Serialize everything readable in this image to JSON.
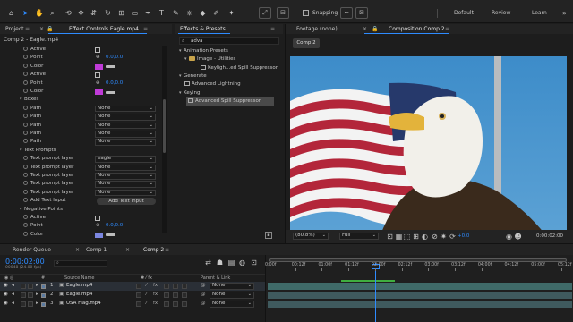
{
  "workspace": {
    "snapping_label": "Snapping",
    "workspaces": [
      "Default",
      "Review",
      "Learn"
    ]
  },
  "left_panel": {
    "tabs": [
      "Project",
      "Effect Controls Eagle.mp4"
    ],
    "header": "Comp 2 - Eagle.mp4",
    "rows": [
      {
        "label": "Active",
        "type": "checkbox"
      },
      {
        "label": "Point",
        "type": "point",
        "value": "0.0,0.0"
      },
      {
        "label": "Color",
        "type": "color",
        "color": "#c03bd8"
      },
      {
        "label": "Active",
        "type": "checkbox"
      },
      {
        "label": "Point",
        "type": "point",
        "value": "0.0,0.0"
      },
      {
        "label": "Color",
        "type": "color",
        "color": "#c03bd8"
      },
      {
        "label": "Boxes",
        "type": "group"
      },
      {
        "label": "Path",
        "type": "dropdown",
        "value": "None"
      },
      {
        "label": "Path",
        "type": "dropdown",
        "value": "None"
      },
      {
        "label": "Path",
        "type": "dropdown",
        "value": "None"
      },
      {
        "label": "Path",
        "type": "dropdown",
        "value": "None"
      },
      {
        "label": "Path",
        "type": "dropdown",
        "value": "None"
      },
      {
        "label": "Text Prompts",
        "type": "group"
      },
      {
        "label": "Text prompt layer",
        "type": "dropdown",
        "value": "eagle"
      },
      {
        "label": "Text prompt layer",
        "type": "dropdown",
        "value": "None"
      },
      {
        "label": "Text prompt layer",
        "type": "dropdown",
        "value": "None"
      },
      {
        "label": "Text prompt layer",
        "type": "dropdown",
        "value": "None"
      },
      {
        "label": "Text prompt layer",
        "type": "dropdown",
        "value": "None"
      },
      {
        "label": "Add Text Input",
        "type": "button",
        "value": "Add Text Input"
      },
      {
        "label": "Negative Points",
        "type": "group"
      },
      {
        "label": "Active",
        "type": "checkbox"
      },
      {
        "label": "Point",
        "type": "point",
        "value": "0.0,0.0"
      },
      {
        "label": "Color",
        "type": "color",
        "color": "#7b86e0"
      }
    ]
  },
  "effects_panel": {
    "tab": "Effects & Presets",
    "search_value": "adva",
    "items": [
      {
        "label": "Animation Presets",
        "kind": "group"
      },
      {
        "label": "Image - Utilities",
        "kind": "folder"
      },
      {
        "label": "Keyligh...ed Spill Suppressor",
        "kind": "preset"
      },
      {
        "label": "Generate",
        "kind": "group"
      },
      {
        "label": "Advanced Lightning",
        "kind": "effect"
      },
      {
        "label": "Keying",
        "kind": "group"
      },
      {
        "label": "Advanced Spill Suppressor",
        "kind": "effect",
        "selected": true
      }
    ]
  },
  "viewer": {
    "tabs": [
      "Footage (none)",
      "Composition Comp 2"
    ],
    "comp_chip": "Comp 2",
    "zoom": "(80.8%)",
    "quality": "Full",
    "exposure": "+0.0",
    "timecode": "0:00:02:00"
  },
  "timeline": {
    "tabs": [
      "Render Queue",
      "Comp 1",
      "Comp 2"
    ],
    "current_time": "0:00:02:00",
    "frame_info": "00048 (24.00 fps)",
    "columns": {
      "num": "#",
      "source": "Source Name",
      "parent": "Parent & Link"
    },
    "ruler": [
      "0:00f",
      "00:12f",
      "01:00f",
      "01:12f",
      "02:00f",
      "02:12f",
      "03:00f",
      "03:12f",
      "04:00f",
      "04:12f",
      "05:00f",
      "05:12f"
    ],
    "layers": [
      {
        "num": "1",
        "name": "Eagle.mp4",
        "parent": "None",
        "selected": true
      },
      {
        "num": "2",
        "name": "Eagle.mp4",
        "parent": "None"
      },
      {
        "num": "3",
        "name": "USA Flag.mp4",
        "parent": "None"
      }
    ]
  },
  "colors": {
    "accent": "#2e8bff",
    "track": "#3f6a68",
    "work_area": "#3fae3f",
    "playhead": "#2e8bff"
  }
}
